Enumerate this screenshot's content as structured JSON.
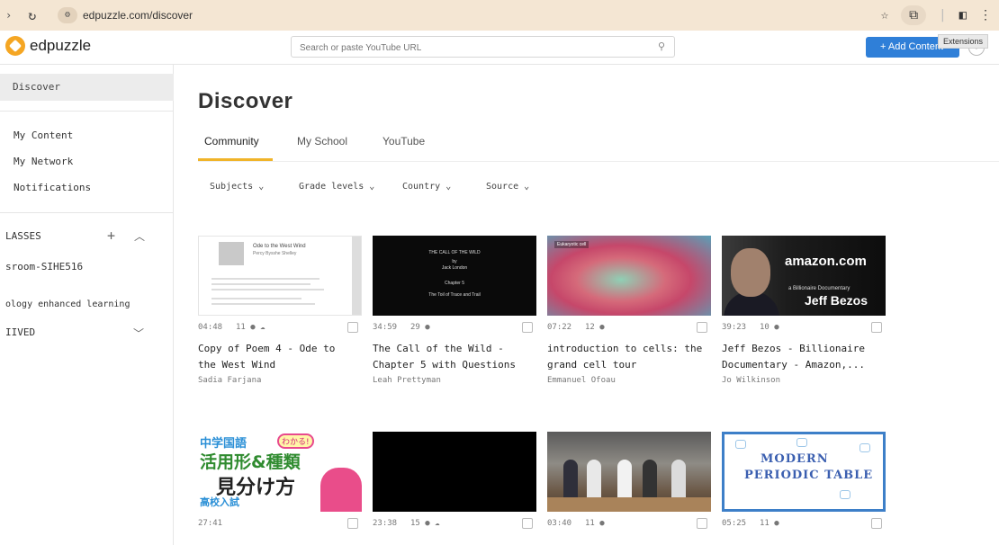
{
  "browser": {
    "url": "edpuzzle.com/discover",
    "tooltip": "Extensions"
  },
  "topbar": {
    "logo_text": "edpuzzle",
    "search_placeholder": "Search or paste YouTube URL",
    "add_content_label": "+ Add Content"
  },
  "sidebar": {
    "discover": "Discover",
    "my_content": "My Content",
    "my_network": "My Network",
    "notifications": "Notifications",
    "classes_header": "LASSES",
    "class_1": "sroom-SIHE516",
    "class_2": "ology enhanced learning",
    "archived": "IIVED"
  },
  "main": {
    "title": "Discover",
    "tabs": [
      "Community",
      "My School",
      "YouTube"
    ],
    "filters": [
      "Subjects",
      "Grade levels",
      "Country",
      "Source"
    ]
  },
  "cards": [
    {
      "duration": "04:48",
      "questions": "11",
      "title": "Copy of Poem 4 - Ode to the West Wind",
      "author": "Sadia Farjana",
      "thumb": {
        "heading": "Ode to the West Wind",
        "sub": "Percy Bysshe Shelley"
      }
    },
    {
      "duration": "34:59",
      "questions": "29",
      "title": "The Call of the Wild - Chapter 5 with Questions",
      "author": "Leah Prettyman",
      "thumb": {
        "l1": "THE CALL OF THE WILD",
        "l2": "by",
        "l3": "Jack London",
        "l4": "Chapter 5",
        "l5": "The Toil of Trace and Trail"
      }
    },
    {
      "duration": "07:22",
      "questions": "12",
      "title": "introduction to cells: the grand cell tour",
      "author": "Emmanuel Ofoau",
      "thumb": {
        "label": "Eukaryotic cell"
      }
    },
    {
      "duration": "39:23",
      "questions": "10",
      "title": "Jeff Bezos - Billionaire Documentary - Amazon,...",
      "author": "Jo Wilkinson",
      "thumb": {
        "brand": "amazon.com",
        "sub": "a Billionaire Documentary",
        "name": "Jeff Bezos"
      }
    },
    {
      "duration": "27:41",
      "questions": "",
      "title": "",
      "author": "",
      "thumb": {
        "a": "中学国語",
        "badge": "わかる!",
        "b": "活用形&種類",
        "c": "見分け方",
        "d": "高校入試"
      }
    },
    {
      "duration": "23:38",
      "questions": "15",
      "title": "",
      "author": ""
    },
    {
      "duration": "03:40",
      "questions": "11",
      "title": "",
      "author": ""
    },
    {
      "duration": "05:25",
      "questions": "11",
      "title": "",
      "author": "",
      "thumb": {
        "l1": "MODERN",
        "l2": "PERIODIC TABLE"
      }
    }
  ],
  "icons": {
    "question": "question-dot-icon",
    "cloud": "cloud-upload-icon"
  },
  "colors": {
    "accent": "#f0b429",
    "primary_button": "#2f7fd8",
    "browser_chrome": "#f4e6d3"
  }
}
